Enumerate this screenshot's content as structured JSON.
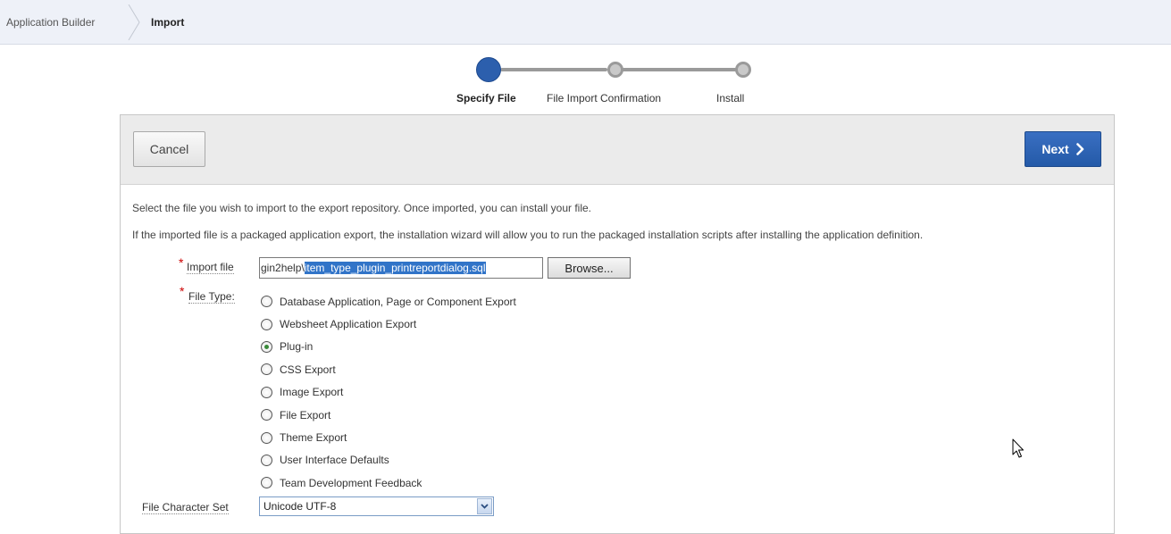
{
  "breadcrumb": {
    "items": [
      {
        "label": "Application Builder"
      },
      {
        "label": "Import"
      }
    ]
  },
  "wizard": {
    "steps": [
      {
        "label": "Specify File",
        "state": "active"
      },
      {
        "label": "File Import Confirmation",
        "state": "pending"
      },
      {
        "label": "Install",
        "state": "pending"
      }
    ],
    "active_color": "#2c5fad"
  },
  "toolbar": {
    "cancel_label": "Cancel",
    "next_label": "Next"
  },
  "instructions": {
    "line1": "Select the file you wish to import to the export repository. Once imported, you can install your file.",
    "line2": "If the imported file is a packaged application export, the installation wizard will allow you to run the packaged installation scripts after installing the application definition."
  },
  "form": {
    "import_file": {
      "label": "Import file",
      "value_prefix": "gin2help\\",
      "value_selected": "item_type_plugin_printreportdialog.sql",
      "browse_label": "Browse..."
    },
    "file_type": {
      "label": "File Type:",
      "options": [
        {
          "label": "Database Application, Page or Component Export",
          "checked": false
        },
        {
          "label": "Websheet Application Export",
          "checked": false
        },
        {
          "label": "Plug-in",
          "checked": true
        },
        {
          "label": "CSS Export",
          "checked": false
        },
        {
          "label": "Image Export",
          "checked": false
        },
        {
          "label": "File Export",
          "checked": false
        },
        {
          "label": "Theme Export",
          "checked": false
        },
        {
          "label": "User Interface Defaults",
          "checked": false
        },
        {
          "label": "Team Development Feedback",
          "checked": false
        }
      ]
    },
    "charset": {
      "label": "File Character Set",
      "value": "Unicode UTF-8"
    }
  }
}
